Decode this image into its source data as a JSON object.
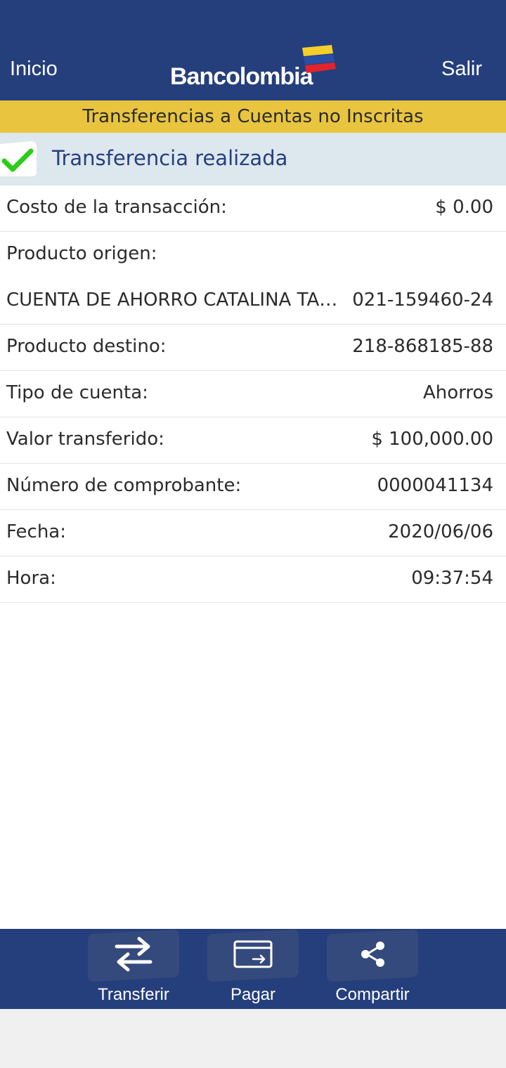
{
  "header": {
    "left_link": "Inicio",
    "brand": "Bancolombia",
    "right_link": "Salir",
    "background": "#253f7d"
  },
  "section_title": "Transferencias a Cuentas no Inscritas",
  "status": {
    "icon": "check-icon",
    "text": "Transferencia realizada"
  },
  "details": [
    {
      "label": "Costo de la transacción:",
      "value": "$ 0.00"
    },
    {
      "label": "Producto origen:",
      "value": ""
    },
    {
      "label": "CUENTA DE AHORRO CATALINA TABARES",
      "value": "021-159460-24"
    },
    {
      "label": "Producto destino:",
      "value": "218-868185-88"
    },
    {
      "label": "Tipo de cuenta:",
      "value": "Ahorros"
    },
    {
      "label": "Valor transferido:",
      "value": "$ 100,000.00"
    },
    {
      "label": "Número de comprobante:",
      "value": "0000041134"
    },
    {
      "label": "Fecha:",
      "value": "2020/06/06"
    },
    {
      "label": "Hora:",
      "value": "09:37:54"
    }
  ],
  "actions": [
    {
      "label": "Transferir",
      "icon": "transfer-arrows-icon"
    },
    {
      "label": "Pagar",
      "icon": "card-pay-icon"
    },
    {
      "label": "Compartir",
      "icon": "share-icon"
    }
  ],
  "colors": {
    "brand_blue": "#253f7d",
    "accent_yellow": "#e9c53f",
    "status_bg": "#dde7ee",
    "success_green": "#2ecc1a"
  }
}
